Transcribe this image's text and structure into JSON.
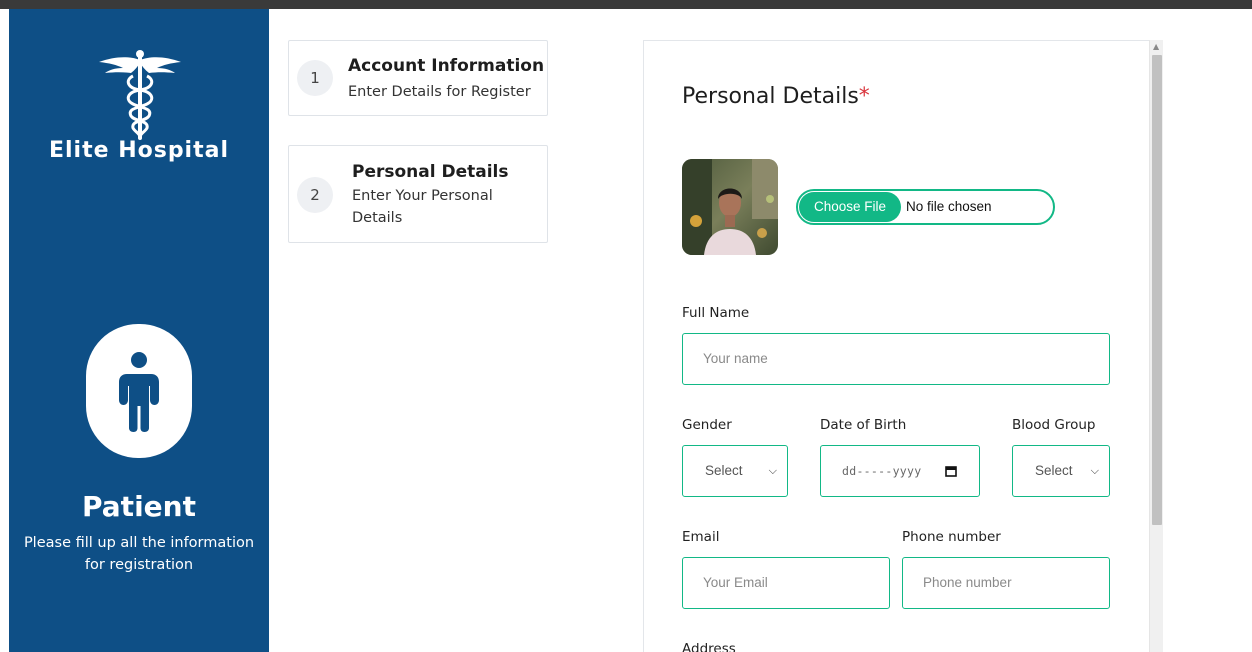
{
  "sidebar": {
    "brand": "Elite Hospital",
    "role_title": "Patient",
    "role_description": "Please fill up all the information for registration",
    "background_color": "#0e4f86"
  },
  "steps": [
    {
      "number": "1",
      "title": "Account Information",
      "subtitle": "Enter Details for Register"
    },
    {
      "number": "2",
      "title": "Personal Details",
      "subtitle": "Enter Your Personal Details"
    }
  ],
  "form": {
    "title": "Personal Details",
    "required_marker": "*",
    "file": {
      "button_label": "Choose File",
      "status": "No file chosen"
    },
    "full_name": {
      "label": "Full Name",
      "placeholder": "Your name"
    },
    "gender": {
      "label": "Gender",
      "value": "Select"
    },
    "dob": {
      "label": "Date of Birth",
      "placeholder": "dd-----yyyy"
    },
    "blood_group": {
      "label": "Blood Group",
      "value": "Select"
    },
    "email": {
      "label": "Email",
      "placeholder": "Your Email"
    },
    "phone": {
      "label": "Phone number",
      "placeholder": "Phone number"
    },
    "address": {
      "label": "Address"
    },
    "accent_color": "#12b886"
  },
  "icons": {
    "logo": "caduceus-icon",
    "role": "person-icon",
    "dropdown": "chevron-down-icon",
    "calendar": "calendar-icon"
  }
}
